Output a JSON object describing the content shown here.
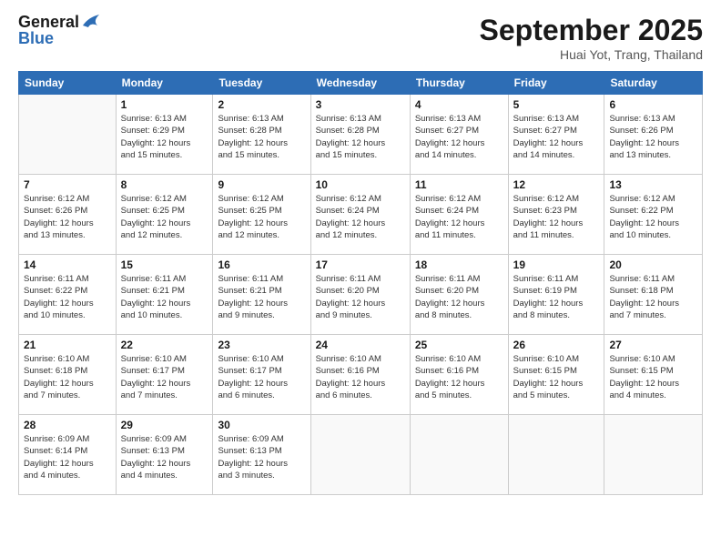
{
  "header": {
    "logo_line1": "General",
    "logo_line2": "Blue",
    "month_title": "September 2025",
    "location": "Huai Yot, Trang, Thailand"
  },
  "days_of_week": [
    "Sunday",
    "Monday",
    "Tuesday",
    "Wednesday",
    "Thursday",
    "Friday",
    "Saturday"
  ],
  "weeks": [
    [
      {
        "day": "",
        "info": ""
      },
      {
        "day": "1",
        "info": "Sunrise: 6:13 AM\nSunset: 6:29 PM\nDaylight: 12 hours\nand 15 minutes."
      },
      {
        "day": "2",
        "info": "Sunrise: 6:13 AM\nSunset: 6:28 PM\nDaylight: 12 hours\nand 15 minutes."
      },
      {
        "day": "3",
        "info": "Sunrise: 6:13 AM\nSunset: 6:28 PM\nDaylight: 12 hours\nand 15 minutes."
      },
      {
        "day": "4",
        "info": "Sunrise: 6:13 AM\nSunset: 6:27 PM\nDaylight: 12 hours\nand 14 minutes."
      },
      {
        "day": "5",
        "info": "Sunrise: 6:13 AM\nSunset: 6:27 PM\nDaylight: 12 hours\nand 14 minutes."
      },
      {
        "day": "6",
        "info": "Sunrise: 6:13 AM\nSunset: 6:26 PM\nDaylight: 12 hours\nand 13 minutes."
      }
    ],
    [
      {
        "day": "7",
        "info": "Sunrise: 6:12 AM\nSunset: 6:26 PM\nDaylight: 12 hours\nand 13 minutes."
      },
      {
        "day": "8",
        "info": "Sunrise: 6:12 AM\nSunset: 6:25 PM\nDaylight: 12 hours\nand 12 minutes."
      },
      {
        "day": "9",
        "info": "Sunrise: 6:12 AM\nSunset: 6:25 PM\nDaylight: 12 hours\nand 12 minutes."
      },
      {
        "day": "10",
        "info": "Sunrise: 6:12 AM\nSunset: 6:24 PM\nDaylight: 12 hours\nand 12 minutes."
      },
      {
        "day": "11",
        "info": "Sunrise: 6:12 AM\nSunset: 6:24 PM\nDaylight: 12 hours\nand 11 minutes."
      },
      {
        "day": "12",
        "info": "Sunrise: 6:12 AM\nSunset: 6:23 PM\nDaylight: 12 hours\nand 11 minutes."
      },
      {
        "day": "13",
        "info": "Sunrise: 6:12 AM\nSunset: 6:22 PM\nDaylight: 12 hours\nand 10 minutes."
      }
    ],
    [
      {
        "day": "14",
        "info": "Sunrise: 6:11 AM\nSunset: 6:22 PM\nDaylight: 12 hours\nand 10 minutes."
      },
      {
        "day": "15",
        "info": "Sunrise: 6:11 AM\nSunset: 6:21 PM\nDaylight: 12 hours\nand 10 minutes."
      },
      {
        "day": "16",
        "info": "Sunrise: 6:11 AM\nSunset: 6:21 PM\nDaylight: 12 hours\nand 9 minutes."
      },
      {
        "day": "17",
        "info": "Sunrise: 6:11 AM\nSunset: 6:20 PM\nDaylight: 12 hours\nand 9 minutes."
      },
      {
        "day": "18",
        "info": "Sunrise: 6:11 AM\nSunset: 6:20 PM\nDaylight: 12 hours\nand 8 minutes."
      },
      {
        "day": "19",
        "info": "Sunrise: 6:11 AM\nSunset: 6:19 PM\nDaylight: 12 hours\nand 8 minutes."
      },
      {
        "day": "20",
        "info": "Sunrise: 6:11 AM\nSunset: 6:18 PM\nDaylight: 12 hours\nand 7 minutes."
      }
    ],
    [
      {
        "day": "21",
        "info": "Sunrise: 6:10 AM\nSunset: 6:18 PM\nDaylight: 12 hours\nand 7 minutes."
      },
      {
        "day": "22",
        "info": "Sunrise: 6:10 AM\nSunset: 6:17 PM\nDaylight: 12 hours\nand 7 minutes."
      },
      {
        "day": "23",
        "info": "Sunrise: 6:10 AM\nSunset: 6:17 PM\nDaylight: 12 hours\nand 6 minutes."
      },
      {
        "day": "24",
        "info": "Sunrise: 6:10 AM\nSunset: 6:16 PM\nDaylight: 12 hours\nand 6 minutes."
      },
      {
        "day": "25",
        "info": "Sunrise: 6:10 AM\nSunset: 6:16 PM\nDaylight: 12 hours\nand 5 minutes."
      },
      {
        "day": "26",
        "info": "Sunrise: 6:10 AM\nSunset: 6:15 PM\nDaylight: 12 hours\nand 5 minutes."
      },
      {
        "day": "27",
        "info": "Sunrise: 6:10 AM\nSunset: 6:15 PM\nDaylight: 12 hours\nand 4 minutes."
      }
    ],
    [
      {
        "day": "28",
        "info": "Sunrise: 6:09 AM\nSunset: 6:14 PM\nDaylight: 12 hours\nand 4 minutes."
      },
      {
        "day": "29",
        "info": "Sunrise: 6:09 AM\nSunset: 6:13 PM\nDaylight: 12 hours\nand 4 minutes."
      },
      {
        "day": "30",
        "info": "Sunrise: 6:09 AM\nSunset: 6:13 PM\nDaylight: 12 hours\nand 3 minutes."
      },
      {
        "day": "",
        "info": ""
      },
      {
        "day": "",
        "info": ""
      },
      {
        "day": "",
        "info": ""
      },
      {
        "day": "",
        "info": ""
      }
    ]
  ]
}
